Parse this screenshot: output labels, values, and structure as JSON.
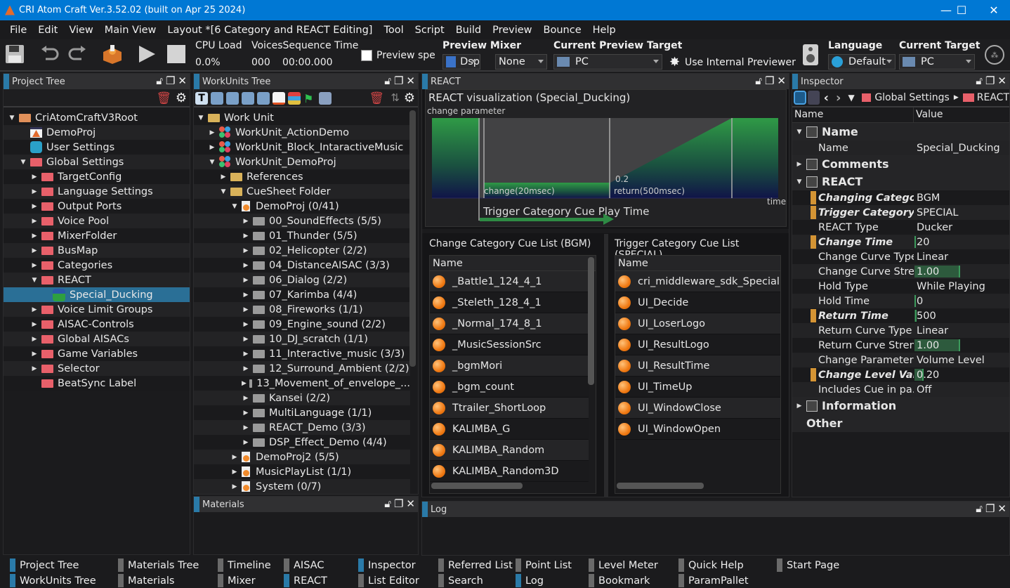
{
  "window": {
    "title": "CRI Atom Craft Ver.3.52.02 (built on Apr 25 2024)",
    "minimize": "—",
    "maximize": "☐",
    "close": "✕"
  },
  "menu": [
    "File",
    "Edit",
    "View",
    "Main View",
    "Layout *[6 Category and REACT Editing]",
    "Tool",
    "Script",
    "Build",
    "Preview",
    "Bounce",
    "Help"
  ],
  "toolbar": {
    "cpu_label": "CPU Load",
    "cpu_value": "0.0%",
    "voices_label": "VoicesSequence Time",
    "voices_value": "000",
    "seq_time": "00:00.000",
    "preview_spe": "Preview spe",
    "preview_mixer_label": "Preview Mixer",
    "mixer_value": "Dsp",
    "mixer_none": "None",
    "current_preview_target_label": "Current Preview Target",
    "preview_target_value": "PC",
    "use_internal_previewer": "Use Internal Previewer",
    "language_label": "Language",
    "language_value": "Default",
    "current_target_label": "Current Target",
    "current_target_value": "PC"
  },
  "project_tree": {
    "title": "Project Tree",
    "items": [
      {
        "label": "CriAtomCraftV3Root",
        "level": 0,
        "twisty": "▼",
        "icon": "folder-orange"
      },
      {
        "label": "DemoProj",
        "level": 1,
        "twisty": "",
        "icon": "project"
      },
      {
        "label": "User Settings",
        "level": 1,
        "twisty": "",
        "icon": "user"
      },
      {
        "label": "Global Settings",
        "level": 1,
        "twisty": "▼",
        "icon": "folder-red"
      },
      {
        "label": "TargetConfig",
        "level": 2,
        "twisty": "▶",
        "icon": "folder-red"
      },
      {
        "label": "Language Settings",
        "level": 2,
        "twisty": "▶",
        "icon": "folder-red"
      },
      {
        "label": "Output Ports",
        "level": 2,
        "twisty": "▶",
        "icon": "folder-red"
      },
      {
        "label": "Voice Pool",
        "level": 2,
        "twisty": "▶",
        "icon": "folder-red"
      },
      {
        "label": "MixerFolder",
        "level": 2,
        "twisty": "▶",
        "icon": "folder-red"
      },
      {
        "label": "BusMap",
        "level": 2,
        "twisty": "▶",
        "icon": "folder-red"
      },
      {
        "label": "Categories",
        "level": 2,
        "twisty": "▶",
        "icon": "folder-red"
      },
      {
        "label": "REACT",
        "level": 2,
        "twisty": "▼",
        "icon": "folder-red"
      },
      {
        "label": "Special_Ducking",
        "level": 3,
        "twisty": "",
        "icon": "react",
        "selected": true
      },
      {
        "label": "Voice Limit Groups",
        "level": 2,
        "twisty": "▶",
        "icon": "folder-red"
      },
      {
        "label": "AISAC-Controls",
        "level": 2,
        "twisty": "▶",
        "icon": "folder-red"
      },
      {
        "label": "Global AISACs",
        "level": 2,
        "twisty": "▶",
        "icon": "folder-red"
      },
      {
        "label": "Game Variables",
        "level": 2,
        "twisty": "▶",
        "icon": "folder-red"
      },
      {
        "label": "Selector",
        "level": 2,
        "twisty": "▶",
        "icon": "folder-red"
      },
      {
        "label": "BeatSync Label",
        "level": 2,
        "twisty": "",
        "icon": "folder-red"
      }
    ]
  },
  "workunits_tree": {
    "title": "WorkUnits Tree",
    "items": [
      {
        "label": "Work Unit",
        "level": 0,
        "twisty": "▼",
        "icon": "folder-yellow"
      },
      {
        "label": "WorkUnit_ActionDemo",
        "level": 1,
        "twisty": "▶",
        "icon": "workunit"
      },
      {
        "label": "WorkUnit_Block_IntaractiveMusic",
        "level": 1,
        "twisty": "▶",
        "icon": "workunit"
      },
      {
        "label": "WorkUnit_DemoProj",
        "level": 1,
        "twisty": "▼",
        "icon": "workunit"
      },
      {
        "label": "References",
        "level": 2,
        "twisty": "▶",
        "icon": "folder-yellow"
      },
      {
        "label": "CueSheet Folder",
        "level": 2,
        "twisty": "▼",
        "icon": "folder-yellow"
      },
      {
        "label": "DemoProj (0/41)",
        "level": 3,
        "twisty": "▼",
        "icon": "cuesheet"
      },
      {
        "label": "00_SoundEffects (5/5)",
        "level": 4,
        "twisty": "▶",
        "icon": "folder-gray"
      },
      {
        "label": "01_Thunder (5/5)",
        "level": 4,
        "twisty": "▶",
        "icon": "folder-gray"
      },
      {
        "label": "02_Helicopter (2/2)",
        "level": 4,
        "twisty": "▶",
        "icon": "folder-gray"
      },
      {
        "label": "04_DistanceAISAC (3/3)",
        "level": 4,
        "twisty": "▶",
        "icon": "folder-gray"
      },
      {
        "label": "06_Dialog (2/2)",
        "level": 4,
        "twisty": "▶",
        "icon": "folder-gray"
      },
      {
        "label": "07_Karimba (4/4)",
        "level": 4,
        "twisty": "▶",
        "icon": "folder-gray"
      },
      {
        "label": "08_Fireworks (1/1)",
        "level": 4,
        "twisty": "▶",
        "icon": "folder-gray"
      },
      {
        "label": "09_Engine_sound (2/2)",
        "level": 4,
        "twisty": "▶",
        "icon": "folder-gray"
      },
      {
        "label": "10_DJ_scratch (1/1)",
        "level": 4,
        "twisty": "▶",
        "icon": "folder-gray"
      },
      {
        "label": "11_Interactive_music (3/3)",
        "level": 4,
        "twisty": "▶",
        "icon": "folder-gray"
      },
      {
        "label": "12_Surround_Ambient (2/2)",
        "level": 4,
        "twisty": "▶",
        "icon": "folder-gray"
      },
      {
        "label": "13_Movement_of_envelope_...",
        "level": 4,
        "twisty": "▶",
        "icon": "folder-gray"
      },
      {
        "label": "Kansei (2/2)",
        "level": 4,
        "twisty": "▶",
        "icon": "folder-gray"
      },
      {
        "label": "MultiLanguage (1/1)",
        "level": 4,
        "twisty": "▶",
        "icon": "folder-gray"
      },
      {
        "label": "REACT_Demo (3/3)",
        "level": 4,
        "twisty": "▶",
        "icon": "folder-gray"
      },
      {
        "label": "DSP_Effect_Demo (4/4)",
        "level": 4,
        "twisty": "▶",
        "icon": "folder-gray"
      },
      {
        "label": "DemoProj2 (5/5)",
        "level": 3,
        "twisty": "▶",
        "icon": "cuesheet"
      },
      {
        "label": "MusicPlayList (1/1)",
        "level": 3,
        "twisty": "▶",
        "icon": "cuesheet"
      },
      {
        "label": "System (0/7)",
        "level": 3,
        "twisty": "▶",
        "icon": "cuesheet"
      }
    ]
  },
  "materials": {
    "title": "Materials"
  },
  "react": {
    "title": "REACT",
    "viz_title": "REACT visualization (Special_Ducking)",
    "y_label": "change parameter",
    "x_label": "time",
    "change_label": "change(20msec)",
    "return_label": "return(500msec)",
    "level_label": "0.2",
    "trigger_label": "Trigger Category Cue Play Time"
  },
  "change_list": {
    "title": "Change Category Cue List (BGM)",
    "header": "Name",
    "items": [
      "_Battle1_124_4_1",
      "_Steleth_128_4_1",
      "_Normal_174_8_1",
      "_MusicSessionSrc",
      "_bgmMori",
      "_bgm_count",
      "Ttrailer_ShortLoop",
      "KALIMBA_G",
      "KALIMBA_Random",
      "KALIMBA_Random3D"
    ]
  },
  "trigger_list": {
    "title": "Trigger Category Cue List (SPECIAL)",
    "header": "Name",
    "items": [
      "cri_middleware_sdk_Special",
      "UI_Decide",
      "UI_LoserLogo",
      "UI_ResultLogo",
      "UI_ResultTime",
      "UI_TimeUp",
      "UI_WindowClose",
      "UI_WindowOpen"
    ]
  },
  "log": {
    "title": "Log"
  },
  "inspector": {
    "title": "Inspector",
    "breadcrumb": [
      "Global Settings",
      "REACT"
    ],
    "col_name": "Name",
    "col_value": "Value",
    "rows": [
      {
        "type": "group",
        "label": "Name",
        "twisty": "▼"
      },
      {
        "name": "Name",
        "value": "Special_Ducking"
      },
      {
        "type": "group",
        "label": "Comments",
        "twisty": "▶"
      },
      {
        "type": "group",
        "label": "REACT",
        "twisty": "▼"
      },
      {
        "name": "Changing Category",
        "value": "BGM",
        "modified": true
      },
      {
        "name": "Trigger Category",
        "value": "SPECIAL",
        "modified": true
      },
      {
        "name": "REACT Type",
        "value": "Ducker"
      },
      {
        "name": "Change Time",
        "value": "20",
        "modified": true,
        "bar": 0.02
      },
      {
        "name": "Change Curve Type",
        "value": "Linear"
      },
      {
        "name": "Change Curve Stre...",
        "value": "1.00",
        "bar": 1.0
      },
      {
        "name": "Hold Type",
        "value": "While Playing"
      },
      {
        "name": "Hold Time",
        "value": "0",
        "bar": 0.0
      },
      {
        "name": "Return Time",
        "value": "500",
        "modified": true,
        "bar": 0.05
      },
      {
        "name": "Return Curve Type",
        "value": "Linear"
      },
      {
        "name": "Return Curve Stren...",
        "value": "1.00",
        "bar": 1.0
      },
      {
        "name": "Change Parameter",
        "value": "Volume Level"
      },
      {
        "name": "Change Level Value",
        "value": "0.20",
        "modified": true,
        "bar": 0.2
      },
      {
        "name": "Includes Cue in pa...",
        "value": "Off"
      },
      {
        "type": "group",
        "label": "Information",
        "twisty": "▶"
      },
      {
        "type": "group",
        "label": "Other",
        "twisty": ""
      }
    ]
  },
  "dock_tabs": [
    [
      "Project Tree",
      "WorkUnits Tree"
    ],
    [
      "Materials Tree",
      "Materials"
    ],
    [
      "Timeline",
      "Mixer"
    ],
    [
      "AISAC",
      "REACT"
    ],
    [
      "Inspector",
      "List Editor"
    ],
    [
      "Referred List",
      "Search"
    ],
    [
      "Point List",
      "Log"
    ],
    [
      "Level Meter",
      "Bookmark"
    ],
    [
      "Quick Help",
      "ParamPallet"
    ],
    [
      "Start Page",
      ""
    ]
  ]
}
